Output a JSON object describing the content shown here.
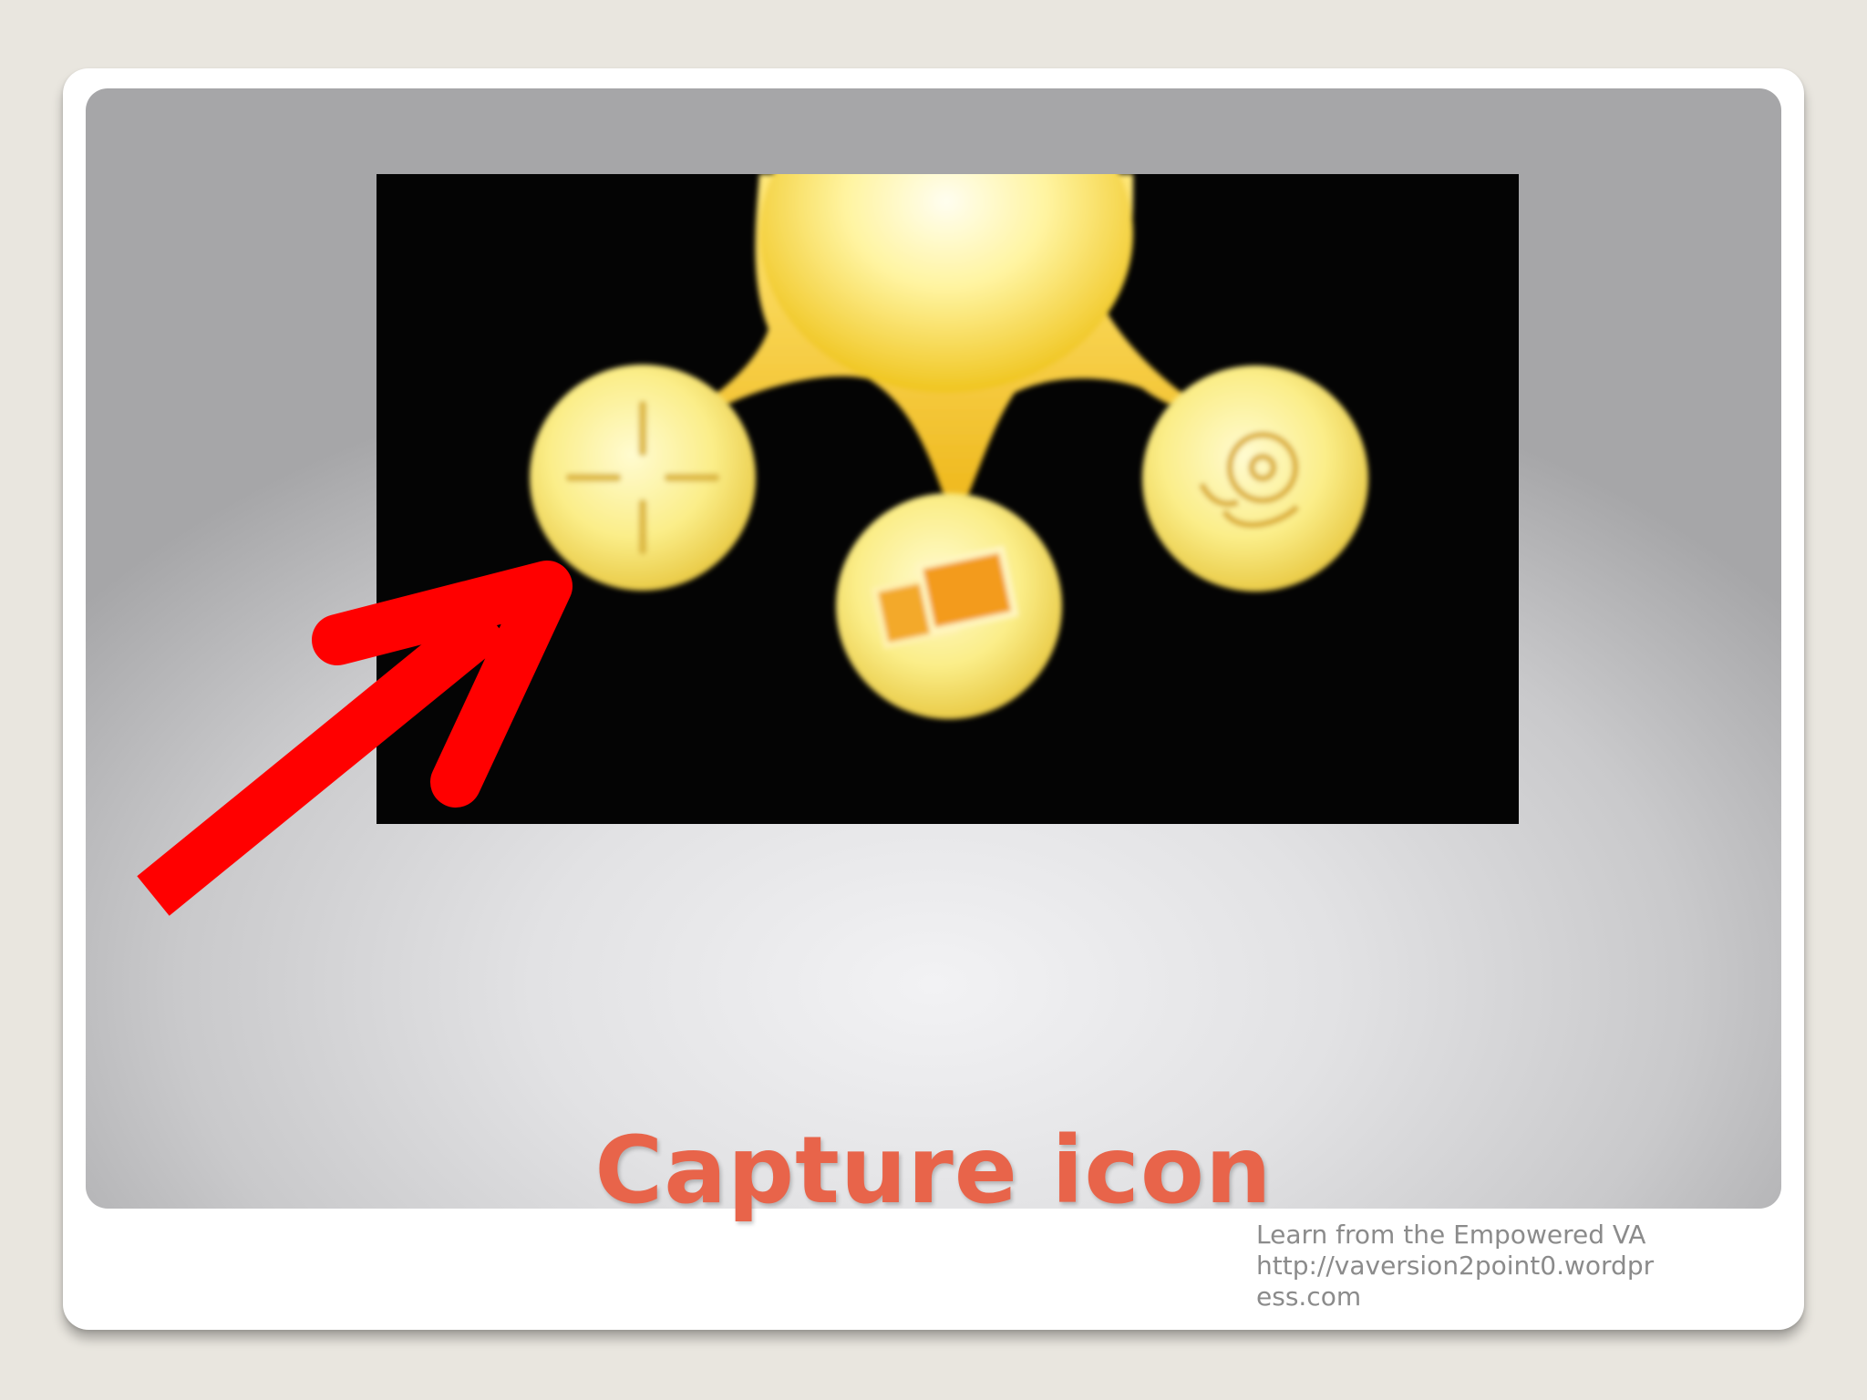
{
  "slide": {
    "title": "Capture icon",
    "footer_lines": [
      "Learn from the Empowered VA",
      "http://vaversion2point0.wordpr",
      "ess.com"
    ]
  },
  "image": {
    "icons": [
      "crosshair-icon",
      "photos-icon",
      "gear-icon"
    ]
  },
  "annotation": {
    "arrow_color": "#ff0000",
    "title_color": "#e8644a"
  }
}
